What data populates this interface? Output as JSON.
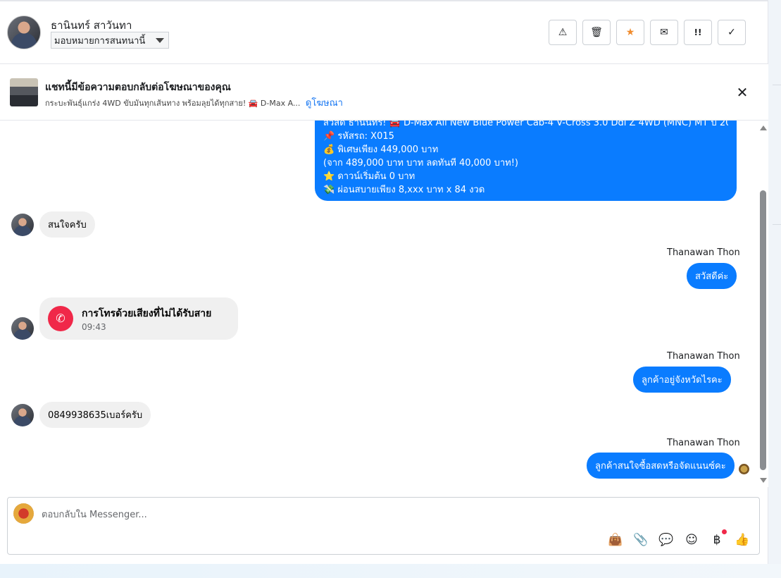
{
  "header": {
    "contact_name": "ธานินทร์ สาวันทา",
    "assign_label": "มอบหมายการสนทนานี้",
    "actions": [
      {
        "name": "report-button",
        "icon": "warning-icon",
        "glyph": "⚠"
      },
      {
        "name": "delete-button",
        "icon": "trash-icon",
        "glyph": "🗑"
      },
      {
        "name": "star-button",
        "icon": "star-icon",
        "glyph": "★"
      },
      {
        "name": "mark-unread-button",
        "icon": "envelope-icon",
        "glyph": "✉"
      },
      {
        "name": "spam-button",
        "icon": "spam-icon",
        "glyph": "!!"
      },
      {
        "name": "mark-done-button",
        "icon": "check-icon",
        "glyph": "✓"
      }
    ]
  },
  "ad_banner": {
    "title": "แชทนี้มีข้อความตอบกลับต่อโฆษณาของคุณ",
    "subtitle": "กระบะพันธุ์แกร่ง 4WD ขับมันทุกเส้นทาง พร้อมลุยได้ทุกสาย! 🚘 D-Max A...",
    "link": "ดูโฆษณา",
    "close_glyph": "✕"
  },
  "conversation": {
    "long_message_lines": [
      "สวัสดี ธานินทร์! 🚘 D-Max All New Blue Power Cab-4 V-Cross 3.0 Ddi Z 4WD (MNC) MT ปี 2018",
      "📌 รหัสรถ: X015",
      "💰 พิเศษเพียง 449,000 บาท",
      "(จาก 489,000 บาท บาท ลดทันที 40,000 บาท!)",
      "⭐ ดาวน์เริ่มต้น 0 บาท",
      "💸 ผ่อนสบายเพียง 8,xxx บาท x 84 งวด"
    ],
    "msg_interested": "สนใจครับ",
    "sender_1": "Thanawan Thon",
    "msg_hello": "สวัสดีค่ะ",
    "call": {
      "icon": "missed-call-icon",
      "glyph": "✆",
      "title": "การโทรด้วยเสียงที่ไม่ได้รับสาย",
      "time": "09:43"
    },
    "sender_2": "Thanawan Thon",
    "msg_province": "ลูกค้าอยู่จังหวัดไรคะ",
    "msg_phone": "0849938635เบอร์ครับ",
    "sender_3": "Thanawan Thon",
    "msg_payment": "ลูกค้าสนใจซื้อสดหรือจัดแนนซ์คะ"
  },
  "composer": {
    "placeholder": "ตอบกลับใน Messenger...",
    "tools": [
      {
        "name": "shopping-bag-icon",
        "glyph": "👜"
      },
      {
        "name": "attachment-icon",
        "glyph": "📎"
      },
      {
        "name": "saved-reply-icon",
        "glyph": "💬"
      },
      {
        "name": "emoji-icon",
        "glyph": "☺"
      },
      {
        "name": "baht-payment-icon",
        "glyph": "฿"
      },
      {
        "name": "thumbs-up-icon",
        "glyph": "👍"
      }
    ]
  }
}
